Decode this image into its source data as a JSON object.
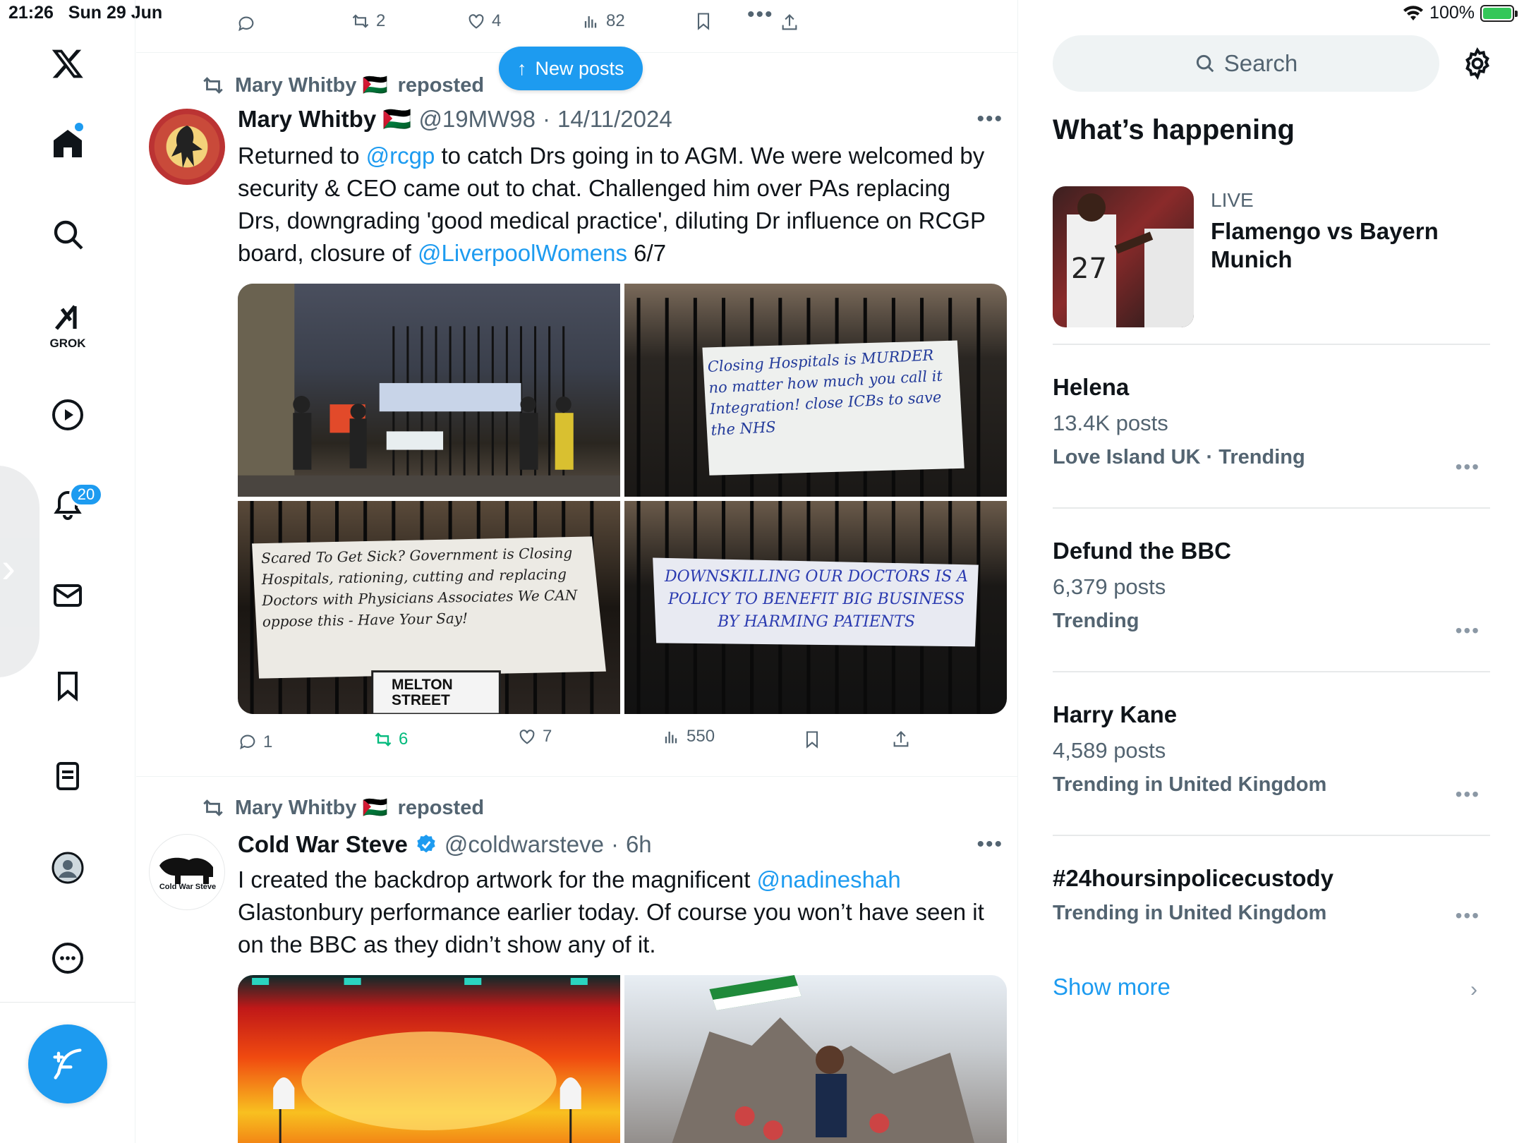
{
  "status_bar": {
    "time": "21:26",
    "date": "Sun 29 Jun",
    "battery": "100%"
  },
  "nav": {
    "grok_label": "GROK",
    "notifications_count": "20"
  },
  "top_post_actions": {
    "reposts": "2",
    "likes": "4",
    "views": "82"
  },
  "new_posts_label": "New posts",
  "posts": [
    {
      "reposted_by": "Mary Whitby 🇵🇸",
      "reposted_suffix": "reposted",
      "author": "Mary Whitby 🇵🇸",
      "handle": "@19MW98",
      "date": "14/11/2024",
      "text_parts": [
        "Returned to ",
        "@rcgp",
        "  to catch Drs going in to AGM. We were welcomed by security & CEO came out to chat. Challenged him over PAs replacing Drs, downgrading 'good medical practice', diluting Dr influence on RCGP board, closure of ",
        "@LiverpoolWomens",
        " 6/7"
      ],
      "banners": [
        "Closing Hospitals is MURDER no matter how much you call it Integration! close ICBs to save the NHS",
        "Scared To Get Sick? Government is Closing Hospitals, rationing, cutting and replacing Doctors with Physicians Associates We CAN oppose this - Have Your Say!",
        "DOWNSKILLING OUR DOCTORS IS A POLICY TO BENEFIT BIG BUSINESS BY HARMING PATIENTS"
      ],
      "sign_text": "MELTON STREET",
      "replies": "1",
      "reposts": "6",
      "likes": "7",
      "views": "550"
    },
    {
      "reposted_by": "Mary Whitby 🇵🇸",
      "reposted_suffix": "reposted",
      "author": "Cold War Steve",
      "avatar_text": "Cold War Steve",
      "handle": "@coldwarsteve",
      "date": "6h",
      "text_parts": [
        "I created the backdrop artwork for the magnificent ",
        "@nadineshah",
        " Glastonbury performance earlier today. Of course you won’t have seen it on the BBC as they didn’t show any of it."
      ]
    }
  ],
  "sidebar": {
    "search_placeholder": "Search",
    "section_title": "What’s happening",
    "live": {
      "label": "LIVE",
      "title": "Flamengo vs Bayern Munich"
    },
    "trends": [
      {
        "name": "Helena",
        "count": "13.4K posts",
        "meta": "Love Island UK · Trending"
      },
      {
        "name": "Defund the BBC",
        "count": "6,379 posts",
        "meta": "Trending"
      },
      {
        "name": "Harry Kane",
        "count": "4,589 posts",
        "meta": "Trending in United Kingdom"
      },
      {
        "name": "#24hoursinpolicecustody",
        "count": "",
        "meta": "Trending in United Kingdom"
      }
    ],
    "show_more": "Show more"
  },
  "colors": {
    "accent": "#1d9bf0",
    "retweet_green": "#00ba7c",
    "muted": "#536471"
  }
}
